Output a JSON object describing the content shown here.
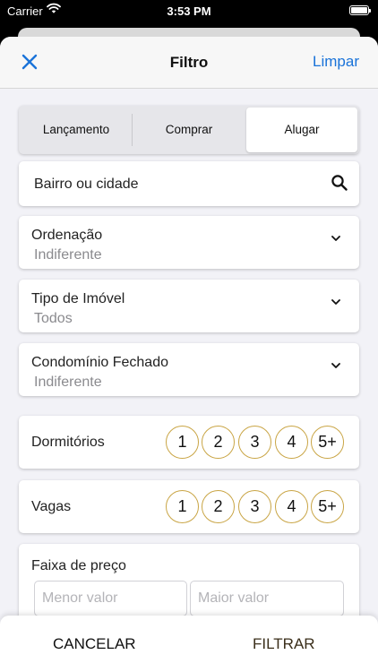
{
  "status_bar": {
    "carrier": "Carrier",
    "time": "3:53 PM"
  },
  "nav": {
    "title": "Filtro",
    "clear_label": "Limpar"
  },
  "segmented": {
    "options": [
      "Lançamento",
      "Comprar",
      "Alugar"
    ],
    "selected": "Alugar"
  },
  "search": {
    "placeholder": "Bairro ou cidade"
  },
  "filters": [
    {
      "label": "Ordenação",
      "value": "Indiferente"
    },
    {
      "label": "Tipo de Imóvel",
      "value": "Todos"
    },
    {
      "label": "Condomínio Fechado",
      "value": "Indiferente"
    }
  ],
  "counters": [
    {
      "label": "Dormitórios",
      "options": [
        "1",
        "2",
        "3",
        "4",
        "5+"
      ]
    },
    {
      "label": "Vagas",
      "options": [
        "1",
        "2",
        "3",
        "4",
        "5+"
      ]
    }
  ],
  "price": {
    "label": "Faixa de preço",
    "min_placeholder": "Menor valor",
    "max_placeholder": "Maior valor"
  },
  "footer": {
    "cancel_label": "CANCELAR",
    "filter_label": "FILTRAR"
  },
  "colors": {
    "accent": "#1a73d9",
    "gold": "#c9a545",
    "background": "#f2f2f7"
  }
}
